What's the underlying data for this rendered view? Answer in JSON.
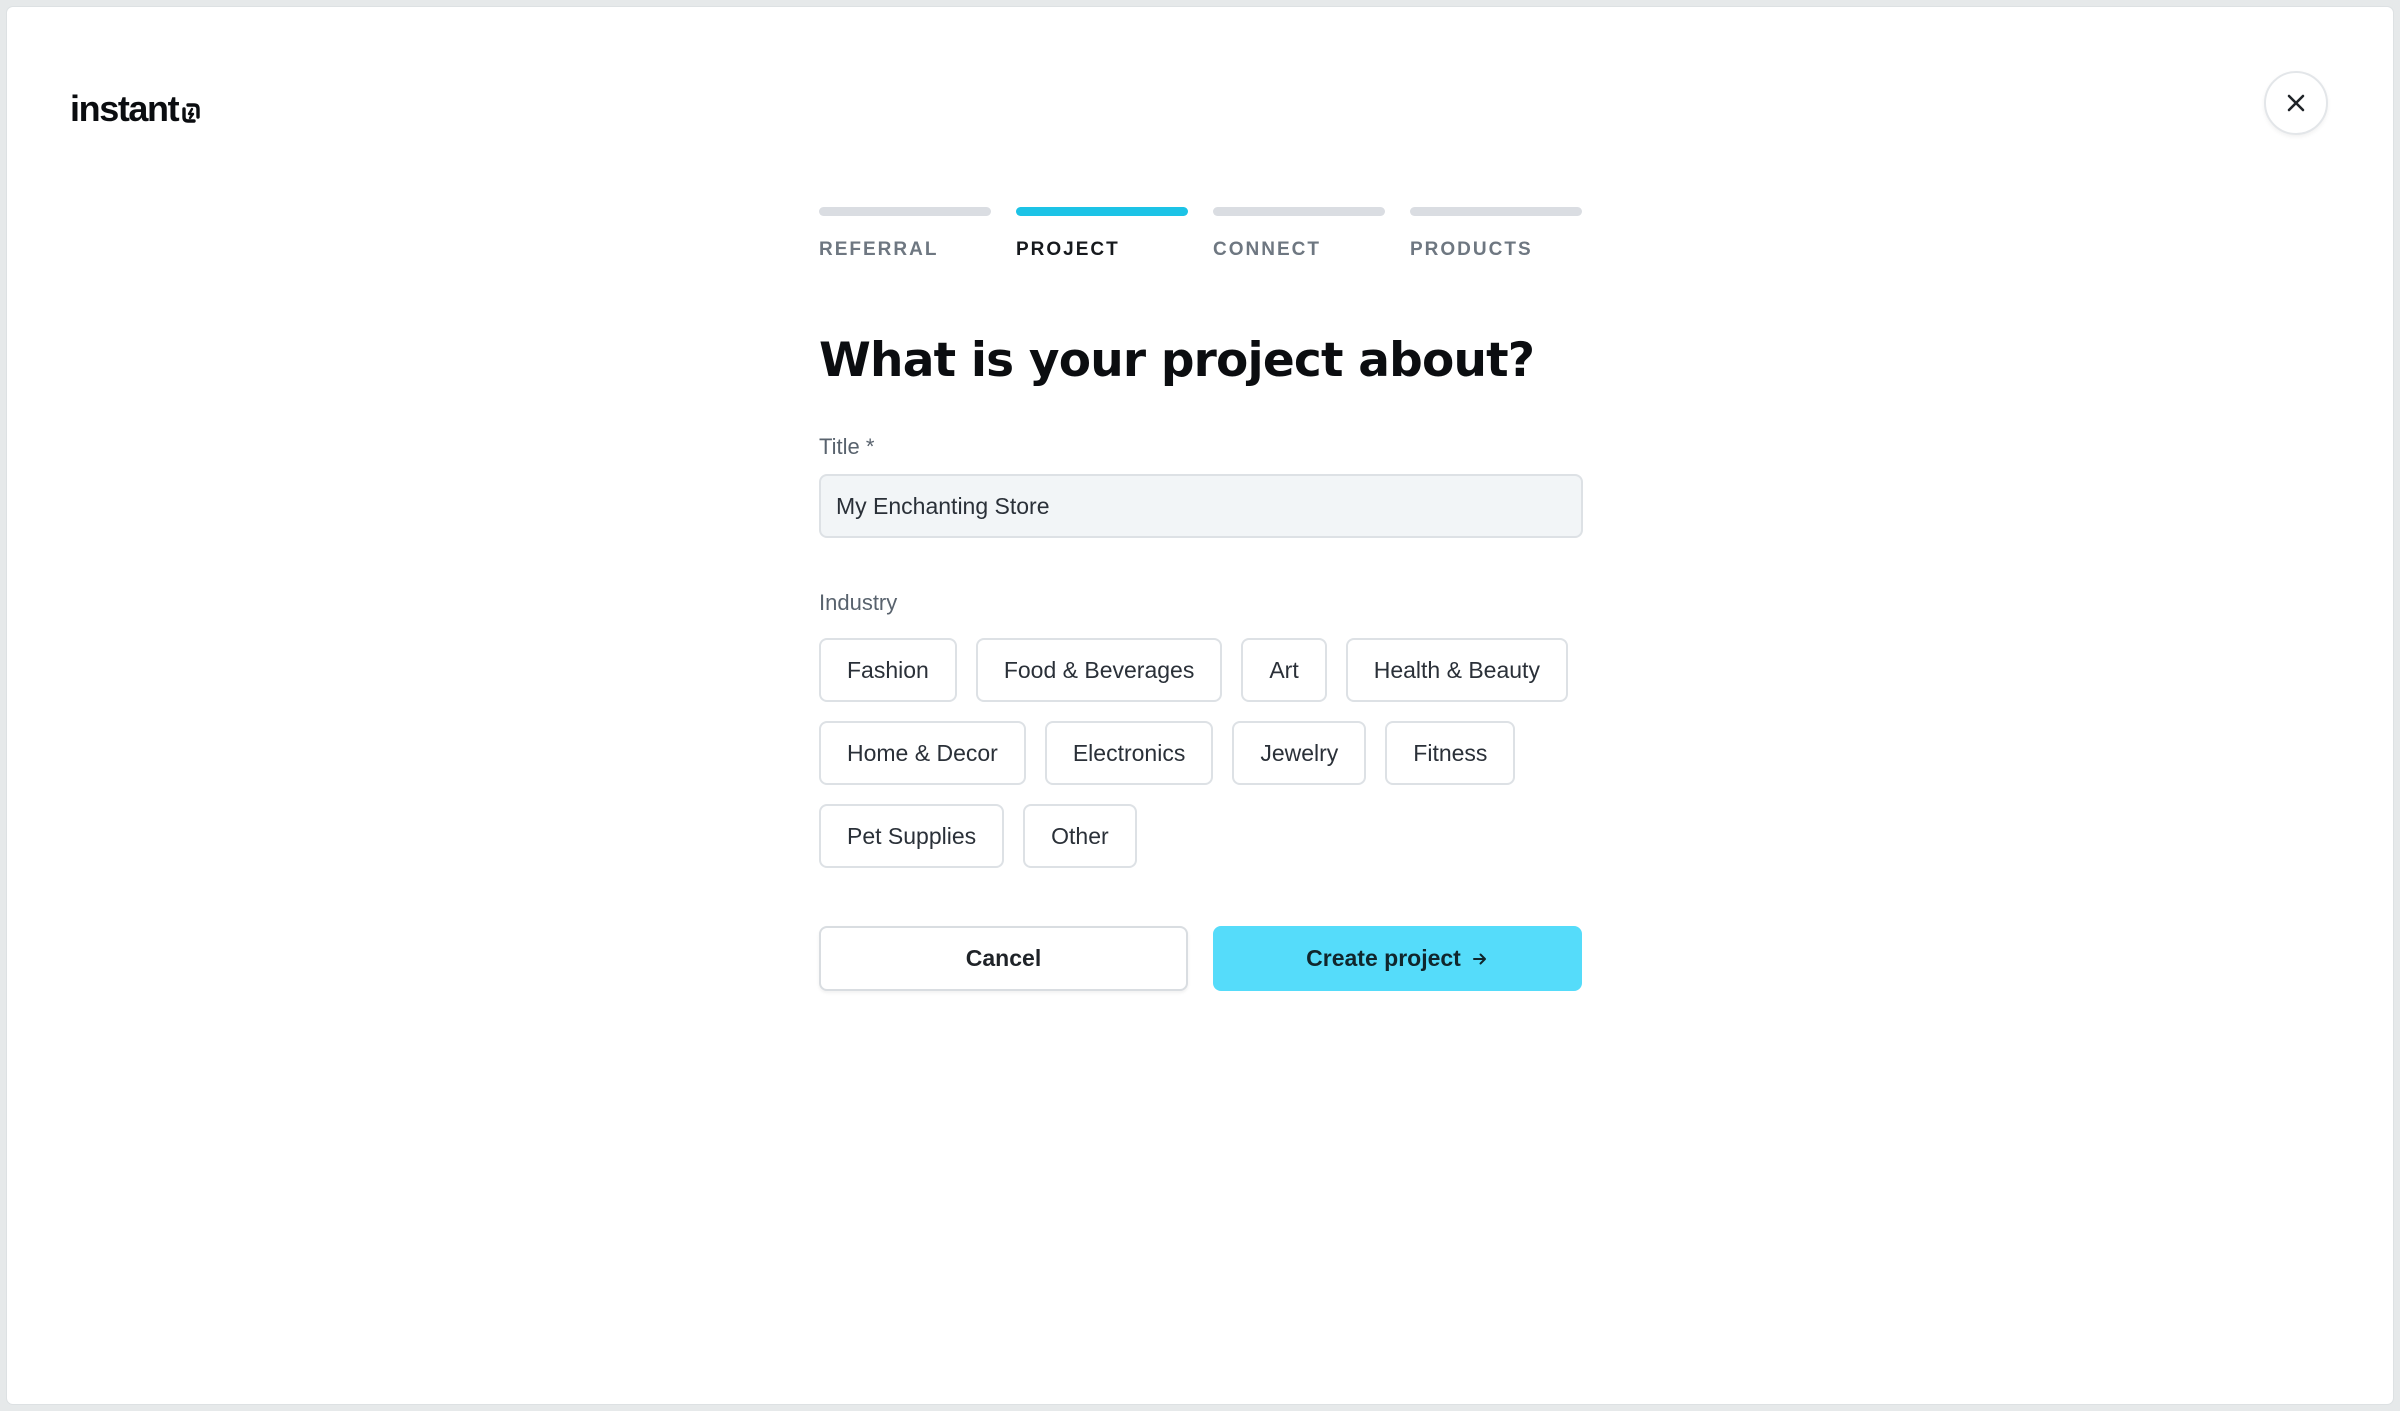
{
  "brand": {
    "logo_text": "instant"
  },
  "close_button": {
    "icon": "close-icon"
  },
  "steps": [
    {
      "label": "REFERRAL",
      "active": false
    },
    {
      "label": "PROJECT",
      "active": true
    },
    {
      "label": "CONNECT",
      "active": false
    },
    {
      "label": "PRODUCTS",
      "active": false
    }
  ],
  "accent_color": "#1cc3e6",
  "cta_color": "#55dcfa",
  "form": {
    "heading": "What is your project about?",
    "title_label": "Title *",
    "title_value": "My Enchanting Store",
    "industry_label": "Industry",
    "industries": [
      "Fashion",
      "Food & Beverages",
      "Art",
      "Health & Beauty",
      "Home & Decor",
      "Electronics",
      "Jewelry",
      "Fitness",
      "Pet Supplies",
      "Other"
    ]
  },
  "actions": {
    "cancel_label": "Cancel",
    "create_label": "Create project",
    "create_icon": "arrow-right-icon"
  }
}
